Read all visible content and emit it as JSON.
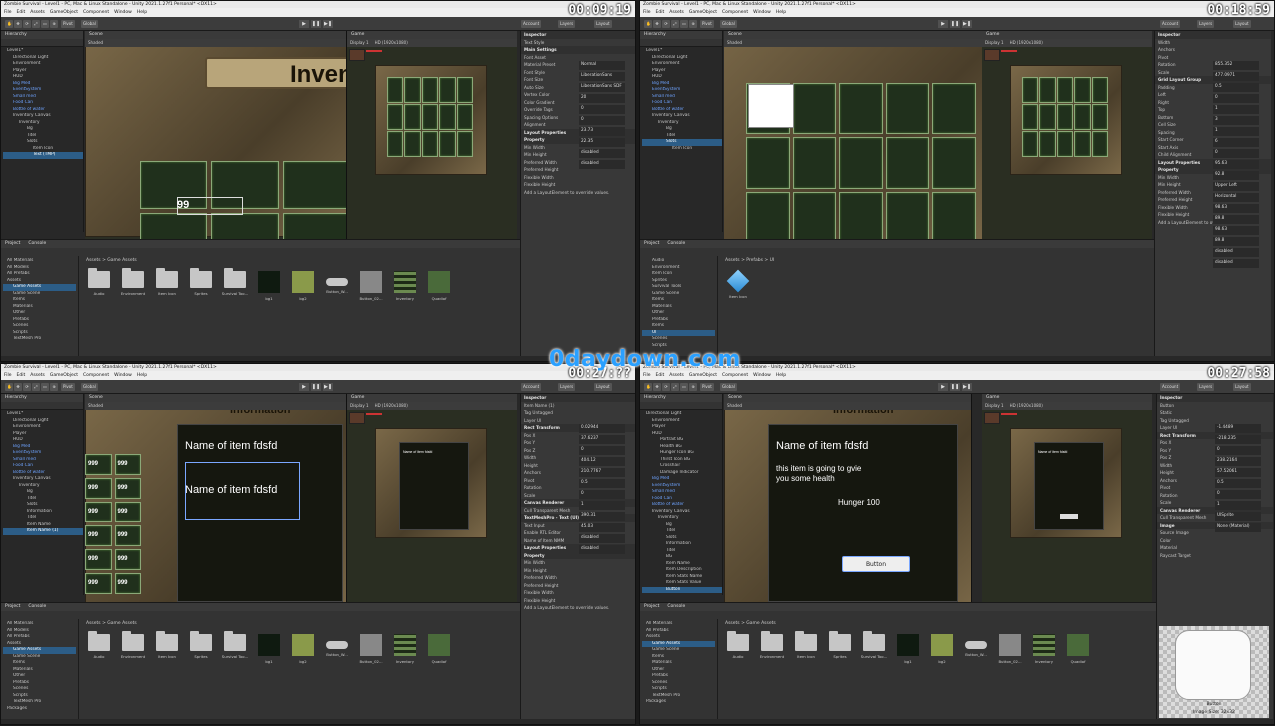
{
  "watermark": "0daydown.com",
  "quadrants": [
    {
      "timestamp": "00:09:19",
      "title": "Zombie Survival - Level1 - PC, Mac & Linux Standalone - Unity 2021.1.27f1 Personal* <DX11>",
      "menu": [
        "File",
        "Edit",
        "Assets",
        "GameObject",
        "Component",
        "Window",
        "Help"
      ],
      "hierarchy": [
        "Level1*",
        "Directional Light",
        "Environment",
        "Player",
        "HUD",
        "Big Med",
        "EventSystem",
        "Small med",
        "Food Can",
        "Bottle of water",
        "Inventory Canvas",
        "Inventory",
        "Bg",
        "Titel",
        "Slots",
        "Item Icon",
        "Text (TMP)"
      ],
      "scene_text": "Inven",
      "scene_number": "99",
      "inspector": [
        "Inspector",
        "Text Style",
        "Main Settings",
        "Font Asset",
        "Material Preset",
        "Font Style",
        "Font Size",
        "Auto Size",
        "Vertex Color",
        "Color Gradient",
        "Override Tags",
        "Spacing Options",
        "Alignment",
        "Layout Properties",
        "Property",
        "Min Width",
        "Min Height",
        "Preferred Width",
        "Preferred Height",
        "Flexible Width",
        "Flexible Height",
        "Add a LayoutElement to override values."
      ],
      "inspector_vals": [
        "Normal",
        "LiberationSans",
        "LiberationSans SDF",
        "20",
        "0",
        "0",
        "23.73",
        "22.35",
        "disabled",
        "disabled"
      ],
      "project_tree": [
        "All Materials",
        "All Models",
        "All Prefabs",
        "Assets",
        "Game Assets",
        "Game Scene",
        "Items",
        "Materials",
        "Other",
        "Prefabs",
        "Scenes",
        "Scripts",
        "TextMesh Pro"
      ],
      "breadcrumb": "Assets > Game Assets",
      "assets": [
        "Audio",
        "Environment",
        "Item Icon",
        "Sprites",
        "Survival Too...",
        "bg1",
        "bg2",
        "Button_W...",
        "Button_02...",
        "Inventory",
        "Quadiof"
      ]
    },
    {
      "timestamp": "00:18:59",
      "hierarchy": [
        "Level1*",
        "Directional Light",
        "Environment",
        "Player",
        "HUD",
        "Big Med",
        "EventSystem",
        "Small med",
        "Food Can",
        "Bottle of water",
        "Inventory Canvas",
        "Inventory",
        "Bg",
        "Titel",
        "Slots",
        "Item Icon"
      ],
      "inspector": [
        "Inspector",
        "Width",
        "Anchors",
        "Pivot",
        "Rotation",
        "Scale",
        "Grid Layout Group",
        "Padding",
        "Left",
        "Right",
        "Top",
        "Bottom",
        "Cell Size",
        "Spacing",
        "Start Corner",
        "Start Axis",
        "Child Alignment",
        "Layout Properties",
        "Property",
        "Min Width",
        "Min Height",
        "Preferred Width",
        "Preferred Height",
        "Flexible Width",
        "Flexible Height",
        "Add a LayoutElement to override values."
      ],
      "inspector_vals": [
        "855.352",
        "477.0971",
        "0.5",
        "0",
        "1",
        "3",
        "1",
        "6",
        "0",
        "95.63",
        "92.8",
        "Upper Left",
        "Horizontal",
        "98.63",
        "89.8",
        "98.63",
        "89.8",
        "disabled",
        "disabled"
      ],
      "project_tree": [
        "Audio",
        "Environment",
        "Item Icon",
        "Sprites",
        "Survival Tools",
        "Game Scene",
        "Items",
        "Materials",
        "Other",
        "Prefabs",
        "Items",
        "UI",
        "Scenes",
        "Scripts"
      ],
      "breadcrumb": "Assets > Prefabs > UI",
      "assets": [
        "Item Icon"
      ]
    },
    {
      "timestamp": "00:27:??",
      "hierarchy": [
        "Level1*",
        "Directional Light",
        "Environment",
        "Player",
        "HUD",
        "Big Med",
        "EventSystem",
        "Small med",
        "Food Can",
        "Bottle of water",
        "Inventory Canvas",
        "Inventory",
        "Bg",
        "Titel",
        "Slots",
        "Information",
        "Titel",
        "Item Name",
        "Item Name (1)"
      ],
      "scene_title": "Name of item fdsfd",
      "scene_dup": "Name of item fdsfd",
      "scene_header": "Information",
      "slot_number": "999",
      "inspector": [
        "Inspector",
        "Item Name (1)",
        "Tag Untagged",
        "Layer UI",
        "Rect Transform",
        "Pos X",
        "Pos Y",
        "Pos Z",
        "Width",
        "Height",
        "Anchors",
        "Pivot",
        "Rotation",
        "Scale",
        "Canvas Renderer",
        "Cull Transparent Mesh",
        "TextMeshPro - Text (UI)",
        "Text Input",
        "Enable RTL Editor",
        "Name of Item NMM",
        "Layout Properties",
        "Property",
        "Min Width",
        "Min Height",
        "Preferred Width",
        "Preferred Height",
        "Flexible Width",
        "Flexible Height",
        "Add a LayoutElement to override values."
      ],
      "inspector_vals": [
        "0.02944",
        "37.6237",
        "0",
        "404.12",
        "210.7767",
        "0.5",
        "0",
        "1",
        "390.31",
        "45.03",
        "disabled",
        "disabled"
      ],
      "project_tree": [
        "All Materials",
        "All Models",
        "All Prefabs",
        "Assets",
        "Game Assets",
        "Game Scene",
        "Items",
        "Materials",
        "Other",
        "Prefabs",
        "Scenes",
        "Scripts",
        "TextMesh Pro",
        "Packages"
      ],
      "breadcrumb": "Assets > Game Assets",
      "assets": [
        "Audio",
        "Environment",
        "Item Icon",
        "Sprites",
        "Survival Too...",
        "bg1",
        "bg2",
        "Button_W...",
        "Button_02...",
        "Inventory",
        "Quadiof"
      ]
    },
    {
      "timestamp": "00:27:58",
      "hierarchy": [
        "Directional Light",
        "Environment",
        "Player",
        "HUD",
        "Portrait BG",
        "Health BG",
        "Hunger Icon BG",
        "Thirst Icon BG",
        "Crosshair",
        "Damage Indicator",
        "Big Med",
        "EventSystem",
        "Small med",
        "Food Can",
        "Bottle of water",
        "Inventory Canvas",
        "Inventory",
        "Bg",
        "Titel",
        "Slots",
        "Information",
        "Titel",
        "BG",
        "Item Name",
        "Item Description",
        "Item Stats Name",
        "Item Stats Value",
        "Button"
      ],
      "scene_title": "Name of item fdsfd",
      "scene_desc1": "this item is going to gvie",
      "scene_desc2": "you some health",
      "scene_stat": "Hunger 100",
      "scene_button": "Button",
      "scene_header": "Information",
      "inspector": [
        "Inspector",
        "Button",
        "Static",
        "Tag Untagged",
        "Layer UI",
        "Rect Transform",
        "Pos X",
        "Pos Y",
        "Pos Z",
        "Width",
        "Height",
        "Anchors",
        "Pivot",
        "Rotation",
        "Scale",
        "Canvas Renderer",
        "Cull Transparent Mesh",
        "Image",
        "Source Image",
        "Color",
        "Material",
        "Raycast Target"
      ],
      "inspector_vals": [
        "-1.4489",
        "-218.235",
        "0",
        "238.2164",
        "57.52061",
        "0.5",
        "0",
        "1",
        "UISprite",
        "None (Material)"
      ],
      "preview_label": "Button",
      "preview_size": "Image Size: 32x32",
      "project_tree": [
        "All Materials",
        "All Prefabs",
        "Assets",
        "Game Assets",
        "Game Scene",
        "Items",
        "Materials",
        "Other",
        "Prefabs",
        "Scenes",
        "Scripts",
        "TextMesh Pro",
        "Packages"
      ],
      "breadcrumb": "Assets > Game Assets",
      "assets": [
        "Audio",
        "Environment",
        "Item Icon",
        "Sprites",
        "Survival Too...",
        "bg1",
        "bg2",
        "Button_W...",
        "Button_02...",
        "Inventory",
        "Quadiof"
      ]
    }
  ],
  "ui": {
    "hierarchy_tab": "Hierarchy",
    "scene_tab": "Scene",
    "game_tab": "Game",
    "project_tab": "Project",
    "console_tab": "Console",
    "shaded": "Shaded",
    "display": "Display 1",
    "resolution": "HD (1920x1080)",
    "scale": "Scale",
    "account": "Account",
    "layers": "Layers",
    "layout": "Layout",
    "gizmos": "Gizmos",
    "global": "Global",
    "pivot": "Pivot",
    "search": "Search",
    "play": "▶",
    "pause": "❚❚",
    "step": "▶❚"
  }
}
